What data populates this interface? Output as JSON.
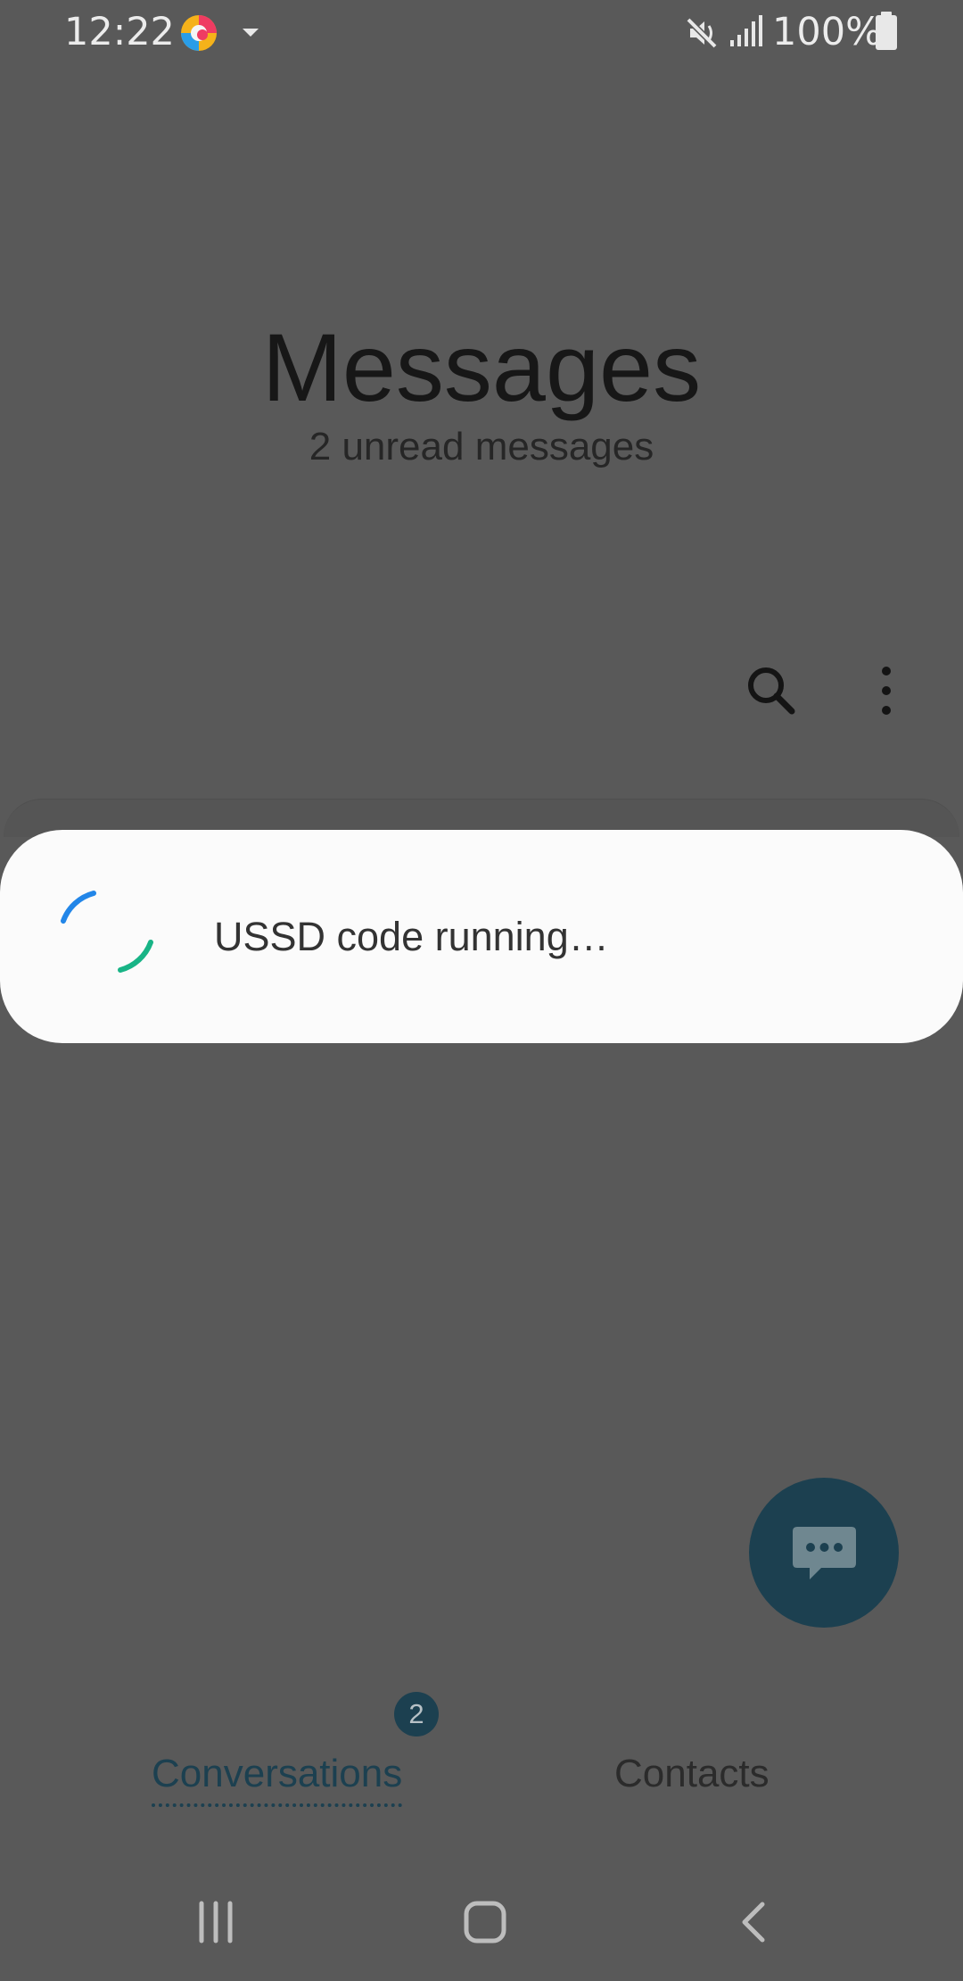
{
  "status_bar": {
    "time": "12:22",
    "battery": "100%",
    "icons": [
      "app-notification-icon",
      "dropdown-icon",
      "mute-icon",
      "signal-icon",
      "battery-icon"
    ]
  },
  "header": {
    "title": "Messages",
    "subtitle": "2 unread messages"
  },
  "actions": {
    "search_icon": "search-icon",
    "more_icon": "more-options-icon"
  },
  "dialog": {
    "text": "USSD code running…"
  },
  "tabs": {
    "conversations": {
      "label": "Conversations",
      "badge": "2"
    },
    "contacts": {
      "label": "Contacts"
    }
  },
  "navigation": {
    "recents_icon": "recent-apps-icon",
    "home_icon": "home-icon",
    "back_icon": "back-icon"
  },
  "colors": {
    "overlay": "#595959",
    "dialog_background": "#fbfbfb",
    "accent": "#1c4050",
    "spinner_blue": "#2286e8",
    "spinner_green": "#18b486"
  }
}
